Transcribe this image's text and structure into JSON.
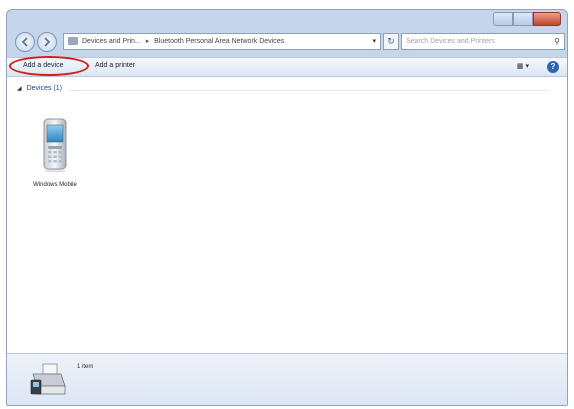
{
  "window": {
    "caption_buttons": [
      "minimize",
      "maximize",
      "close"
    ]
  },
  "navigation": {
    "breadcrumb": [
      "Devices and Prin...",
      "Bluetooth Personal Area Network Devices"
    ],
    "search_placeholder": "Search Devices and Printers"
  },
  "toolbar": {
    "add_device": "Add a device",
    "add_printer": "Add a printer"
  },
  "content": {
    "group_label": "Devices (1)",
    "devices": [
      {
        "label": "Windows Mobile",
        "icon": "mobile-phone-icon"
      }
    ]
  },
  "details": {
    "count_text": "1 item",
    "icon": "printer-device-icon"
  },
  "colors": {
    "highlight": "#d21f1f",
    "frame": "#c5d5ea",
    "group_text": "#1e3f8a"
  }
}
